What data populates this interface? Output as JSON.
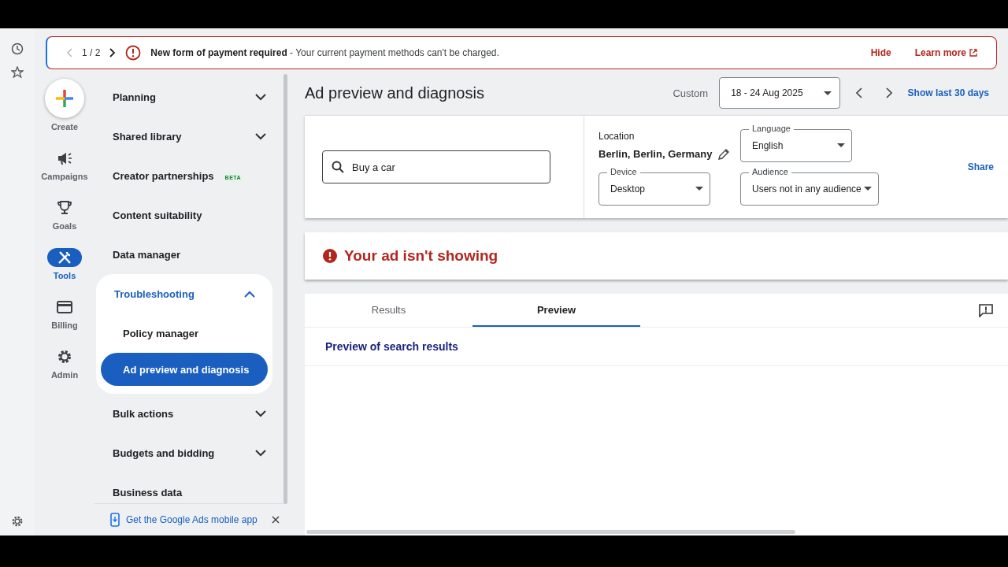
{
  "banner": {
    "pager": "1 / 2",
    "message": "**New form of payment required** - Your current payment methods can't be charged.",
    "actions": [
      "Hide",
      "Learn more"
    ]
  },
  "nav_rail": {
    "create_label": "Create",
    "items": [
      {
        "label": "Campaigns",
        "kind": "campaigns",
        "selected": false
      },
      {
        "label": "Goals",
        "kind": "goals",
        "selected": false
      },
      {
        "label": "Tools",
        "kind": "tools",
        "selected": true
      },
      {
        "label": "Billing",
        "kind": "billing",
        "selected": false
      },
      {
        "label": "Admin",
        "kind": "admin",
        "selected": false
      }
    ]
  },
  "menu": {
    "items": [
      {
        "label": "Planning",
        "expanded": false
      },
      {
        "label": "Shared library",
        "expanded": false
      },
      {
        "label": "Creator partnerships",
        "badge": "BETA"
      },
      {
        "label": "Content suitability"
      },
      {
        "label": "Data manager"
      },
      {
        "label": "Troubleshooting",
        "expanded": true,
        "children": [
          {
            "label": "Policy manager",
            "selected": false
          },
          {
            "label": "Ad preview and diagnosis",
            "selected": true
          }
        ]
      },
      {
        "label": "Bulk actions",
        "expanded": false
      },
      {
        "label": "Budgets and bidding",
        "expanded": false
      },
      {
        "label": "Business data"
      }
    ],
    "promo": "Get the Google Ads mobile app"
  },
  "page": {
    "title": "Ad preview and diagnosis",
    "date_label": "Custom",
    "date_range": "18 - 24 Aug 2025",
    "show_last": "Show last 30 days"
  },
  "search": {
    "value": "Buy a car"
  },
  "location": {
    "label": "Location",
    "value": "Berlin, Berlin, Germany"
  },
  "language": {
    "label": "Language",
    "value": "English"
  },
  "device": {
    "label": "Device",
    "value": "Desktop"
  },
  "audience": {
    "label": "Audience",
    "value": "Users not in any audience"
  },
  "share": "Share",
  "status": {
    "message": "Your ad isn't showing"
  },
  "tabs": [
    {
      "label": "Results",
      "selected": false
    },
    {
      "label": "Preview",
      "selected": true
    }
  ],
  "preview_heading": "Preview of search results"
}
